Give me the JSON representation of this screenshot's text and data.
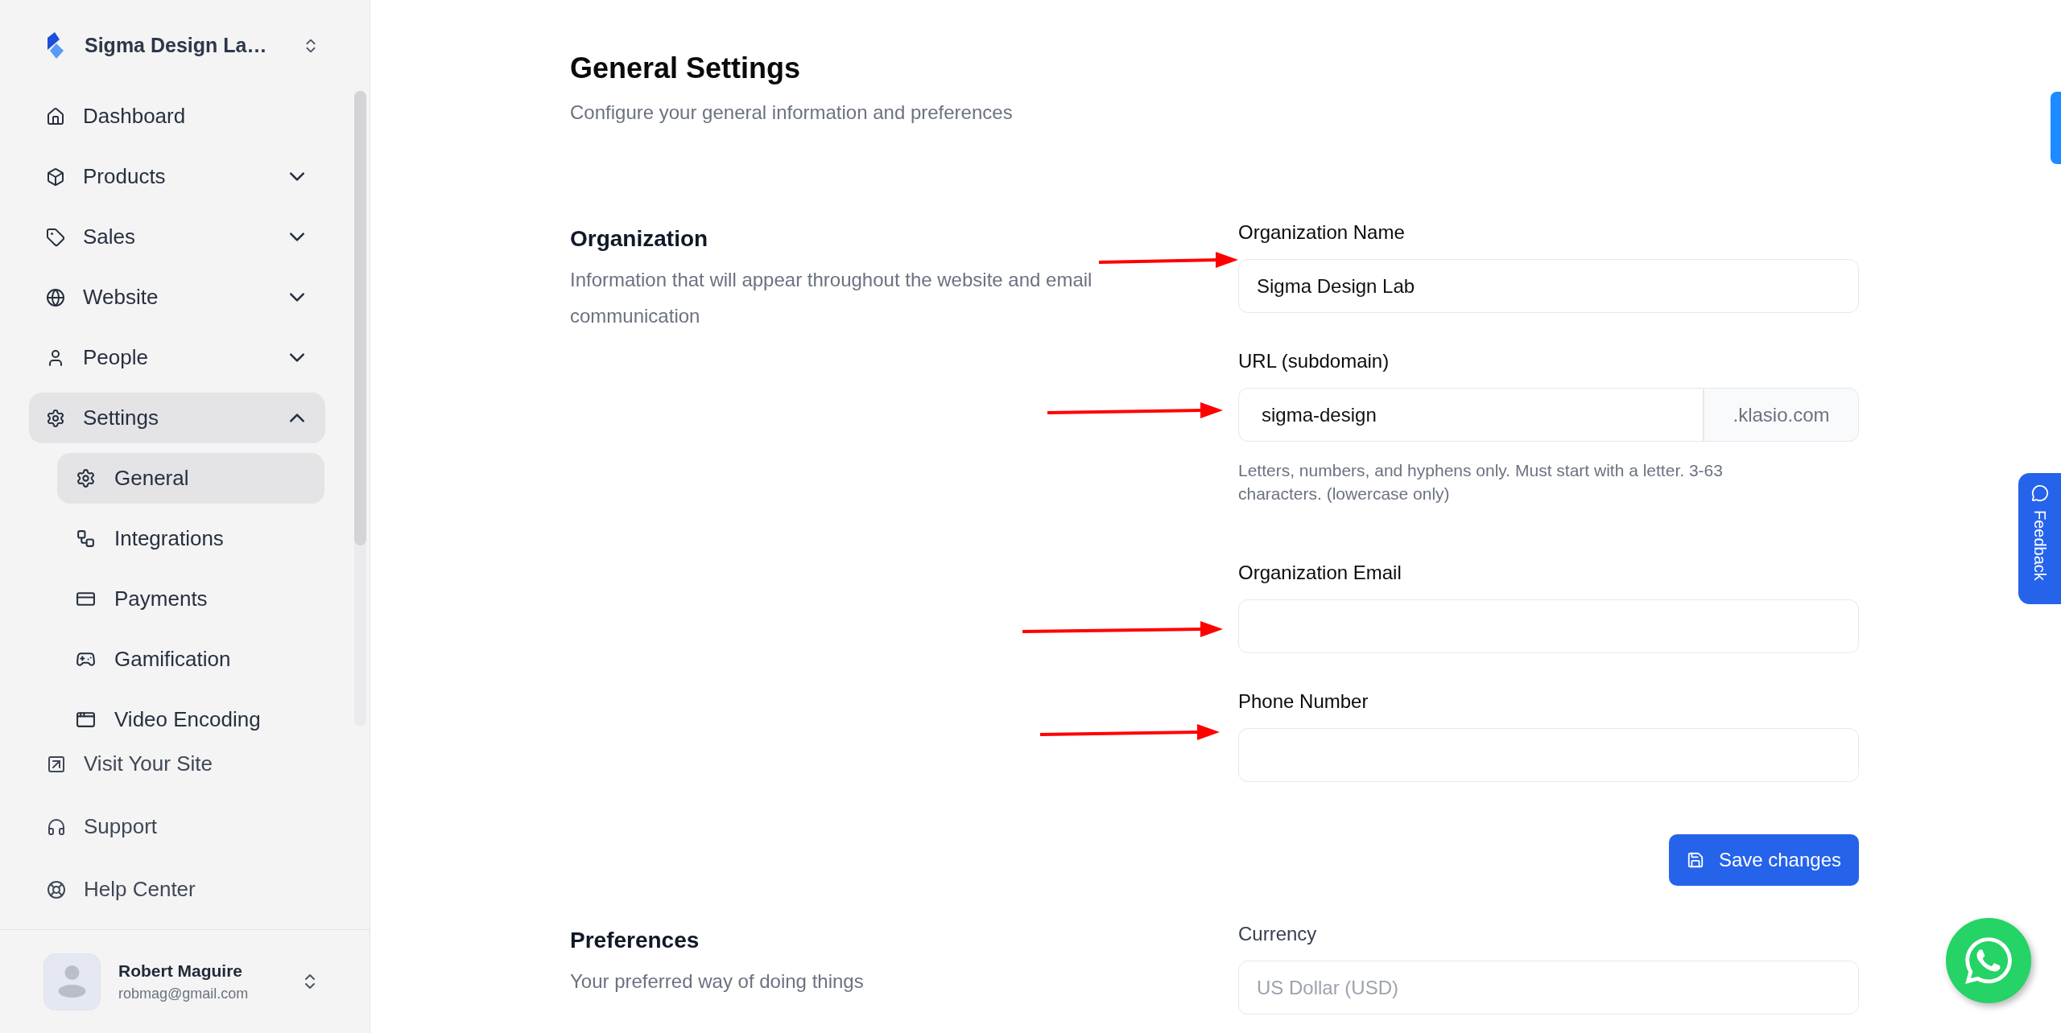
{
  "sidebar": {
    "organization": "Sigma Design La…",
    "nav": [
      {
        "kind": "link",
        "label": "Dashboard",
        "selected": false
      },
      {
        "kind": "group",
        "label": "Products",
        "selected": false,
        "expanded": false
      },
      {
        "kind": "group",
        "label": "Sales",
        "selected": false,
        "expanded": false
      },
      {
        "kind": "group",
        "label": "Website",
        "selected": false,
        "expanded": false
      },
      {
        "kind": "group",
        "label": "People",
        "selected": false,
        "expanded": false
      },
      {
        "kind": "group",
        "label": "Settings",
        "selected": true,
        "expanded": true,
        "children": [
          {
            "label": "General",
            "selected": true
          },
          {
            "label": "Integrations",
            "selected": false
          },
          {
            "label": "Payments",
            "selected": false
          },
          {
            "label": "Gamification",
            "selected": false
          },
          {
            "label": "Video Encoding",
            "selected": false
          }
        ]
      }
    ],
    "links": [
      "Visit Your Site",
      "Support",
      "Help Center"
    ],
    "user": {
      "name": "Robert Maguire",
      "email": "robmag@gmail.com"
    }
  },
  "main": {
    "title": "General Settings",
    "subtitle": "Configure your general information and preferences",
    "sections": [
      {
        "title": "Organization",
        "description": "Information that will appear throughout the website and email communication",
        "fields": [
          {
            "kind": "text",
            "label": "Organization Name",
            "value": "Sigma Design Lab",
            "disabled": false,
            "arrow": true
          },
          {
            "kind": "addon",
            "label": "URL (subdomain)",
            "value": "sigma-design",
            "suffix": ".klasio.com",
            "hint": "Letters, numbers, and hyphens only. Must start with a letter. 3-63 characters. (lowercase only)",
            "disabled": false,
            "arrow": true
          },
          {
            "kind": "text",
            "label": "Organization Email",
            "disabled": false,
            "arrow": true
          },
          {
            "kind": "text",
            "label": "Phone Number",
            "disabled": false,
            "arrow": true
          }
        ],
        "save_button": "Save changes"
      },
      {
        "title": "Preferences",
        "description": "Your preferred way of doing things",
        "fields": [
          {
            "kind": "text",
            "label": "Currency",
            "value": "US Dollar (USD)",
            "disabled": true
          }
        ]
      }
    ]
  },
  "feedback_tab": {
    "label": "Feedback"
  }
}
